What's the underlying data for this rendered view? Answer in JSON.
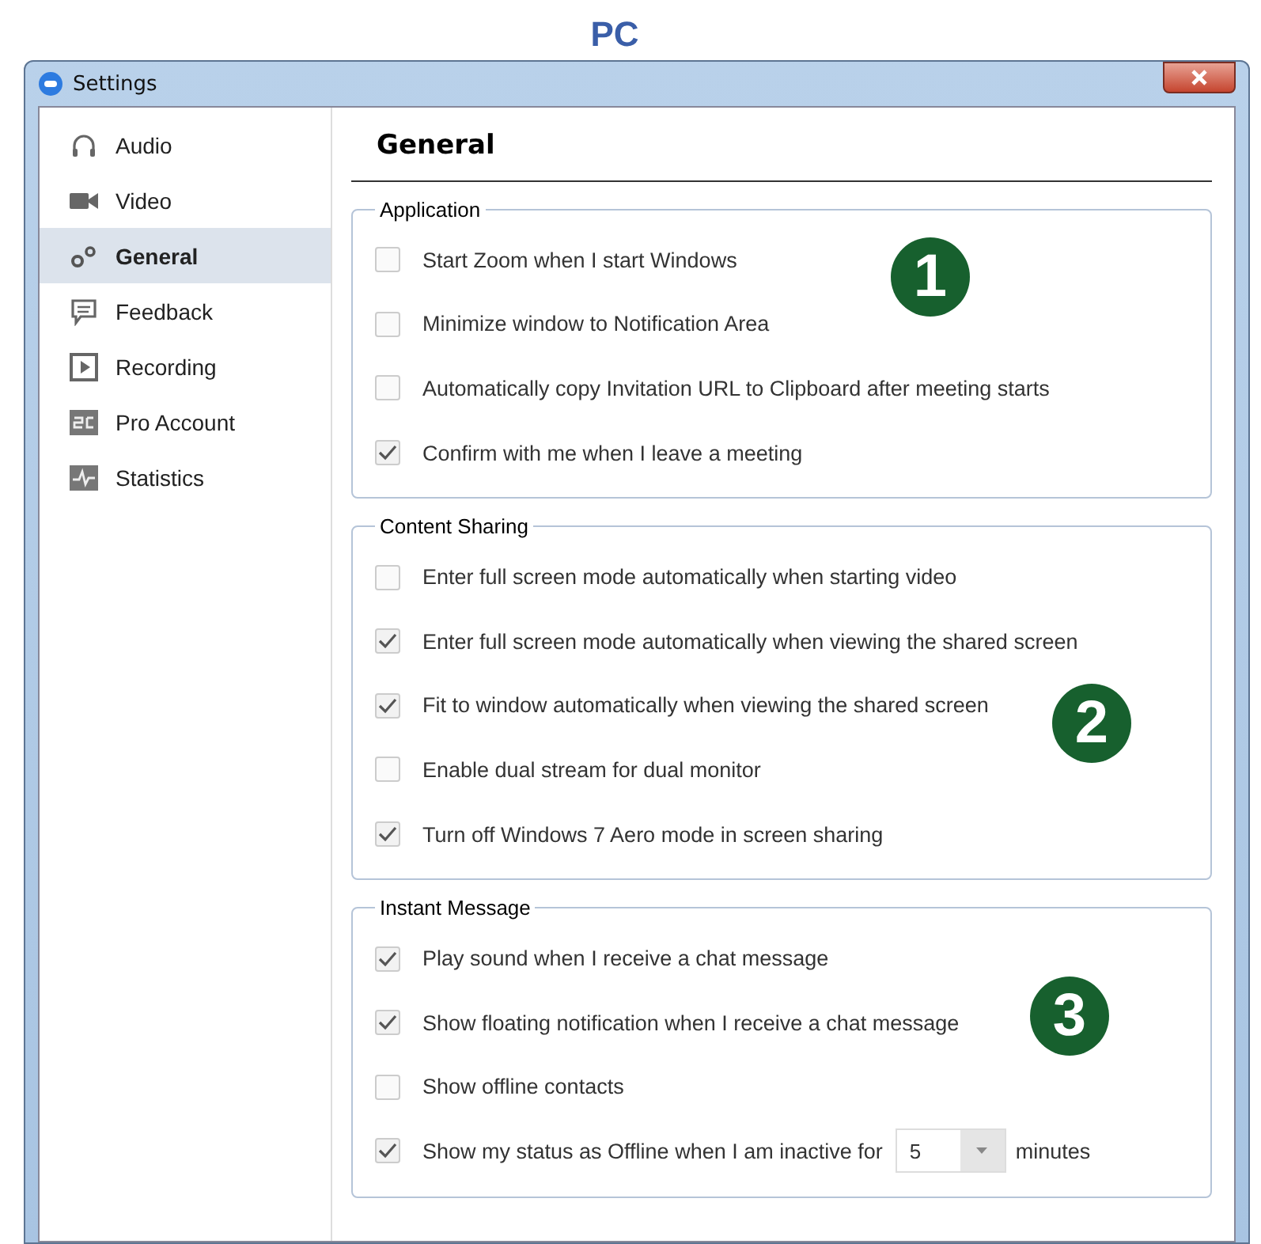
{
  "heading": "PC",
  "window": {
    "title": "Settings"
  },
  "sidebar": {
    "items": [
      {
        "label": "Audio",
        "selected": false
      },
      {
        "label": "Video",
        "selected": false
      },
      {
        "label": "General",
        "selected": true
      },
      {
        "label": "Feedback",
        "selected": false
      },
      {
        "label": "Recording",
        "selected": false
      },
      {
        "label": "Pro Account",
        "selected": false
      },
      {
        "label": "Statistics",
        "selected": false
      }
    ]
  },
  "page_title": "General",
  "groups": [
    {
      "title": "Application",
      "badge": "1",
      "options": [
        {
          "label": "Start Zoom when I start Windows",
          "checked": false
        },
        {
          "label": "Minimize window to Notification Area",
          "checked": false
        },
        {
          "label": "Automatically copy Invitation URL to Clipboard after meeting starts",
          "checked": false
        },
        {
          "label": "Confirm with me when I leave a meeting",
          "checked": true
        }
      ]
    },
    {
      "title": "Content Sharing",
      "badge": "2",
      "options": [
        {
          "label": "Enter full screen mode automatically when starting video",
          "checked": false
        },
        {
          "label": "Enter full screen mode automatically when viewing the shared screen",
          "checked": true
        },
        {
          "label": "Fit to window automatically when viewing the shared screen",
          "checked": true
        },
        {
          "label": "Enable dual stream for dual monitor",
          "checked": false
        },
        {
          "label": "Turn off Windows 7 Aero mode in screen sharing",
          "checked": true
        }
      ]
    },
    {
      "title": "Instant Message",
      "badge": "3",
      "options": [
        {
          "label": "Play sound when I receive a chat message",
          "checked": true
        },
        {
          "label": "Show floating notification when I receive a chat message",
          "checked": true
        },
        {
          "label": "Show offline contacts",
          "checked": false
        },
        {
          "label": "Show my status as Offline when I am inactive for",
          "checked": true,
          "select_value": "5",
          "suffix": "minutes"
        }
      ]
    }
  ]
}
